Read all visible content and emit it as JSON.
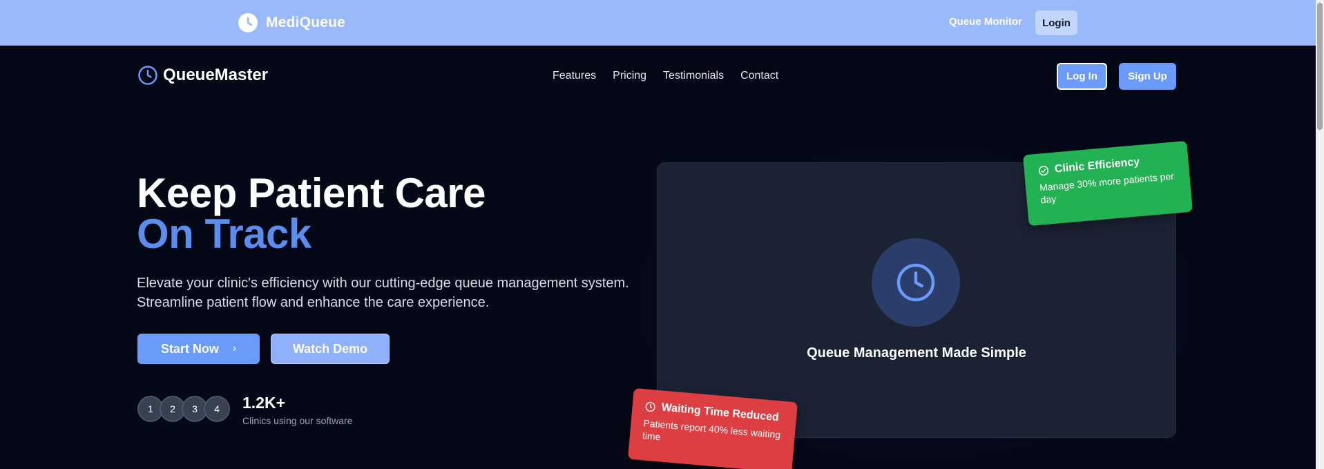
{
  "topbar": {
    "brand": "MediQueue",
    "queue_monitor": "Queue Monitor",
    "login": "Login"
  },
  "nav": {
    "logo": "QueueMaster",
    "links": [
      "Features",
      "Pricing",
      "Testimonials",
      "Contact"
    ],
    "login_button": "Log In",
    "signup_button": "Sign Up"
  },
  "hero": {
    "title_line1": "Keep Patient Care",
    "title_line2": "On Track",
    "subtitle": "Elevate your clinic's efficiency with our cutting-edge queue management system. Streamline patient flow and enhance the care experience.",
    "start_button": "Start Now",
    "demo_button": "Watch Demo",
    "avatars": [
      "1",
      "2",
      "3",
      "4"
    ],
    "stat_value": "1.2K+",
    "stat_label": "Clinics using our software"
  },
  "showcase": {
    "title": "Queue Management Made Simple",
    "efficiency": {
      "title": "Clinic Efficiency",
      "text": "Manage 30% more patients per day"
    },
    "waiting": {
      "title": "Waiting Time Reduced",
      "text": "Patients report 40% less waiting time"
    }
  },
  "icons": {
    "brand": "clock-icon",
    "logo": "clock-icon",
    "start_chevron": "chevron-right-icon",
    "efficiency": "check-circle-icon",
    "waiting": "clock-icon"
  },
  "colors": {
    "topbar_bg": "#9ab9fb",
    "page_bg": "#050816",
    "accent": "#6a9bfa",
    "title_accent": "#5b8def",
    "card_bg": "#1b2234",
    "success": "#22b153",
    "danger": "#dc3e42"
  }
}
